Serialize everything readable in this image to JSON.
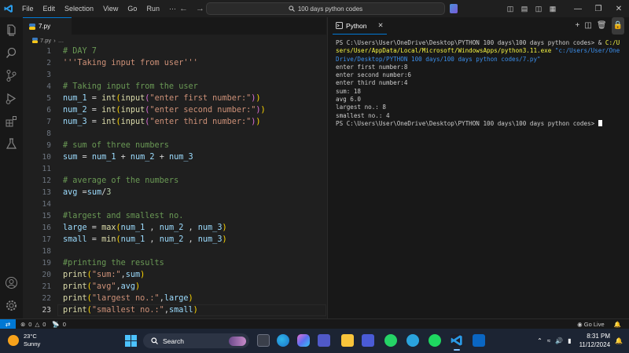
{
  "titlebar": {
    "menu": [
      "File",
      "Edit",
      "Selection",
      "View",
      "Go",
      "Run",
      "···"
    ],
    "search_text": "100 days python codes"
  },
  "editor": {
    "tab_label": "7.py",
    "breadcrumb_file": "7.py",
    "breadcrumb_more": "…",
    "line_numbers": [
      "1",
      "2",
      "3",
      "4",
      "5",
      "6",
      "7",
      "8",
      "9",
      "10",
      "11",
      "12",
      "13",
      "14",
      "15",
      "16",
      "17",
      "18",
      "19",
      "20",
      "21",
      "22",
      "23"
    ],
    "current_line": 23,
    "code": {
      "l1": "# DAY 7",
      "l2": "'''Taking input from user'''",
      "l4": "# Taking input from the user",
      "l5_var": "num_1",
      "l5_str": "\"enter first number:\"",
      "l6_var": "num_2",
      "l6_str": "\"enter second number:\"",
      "l7_var": "num_3",
      "l7_str": "\"enter third number:\"",
      "l9": "# sum of three numbers",
      "l12": "# average of the numbers",
      "l15": "#largest and smallest no.",
      "l19": "#printing the results",
      "l20_str": "\"sum:\"",
      "l21_str": "\"avg\"",
      "l22_str": "\"largest no.:\"",
      "l23_str": "\"smallest no.:\""
    }
  },
  "panel": {
    "tab_label": "Python",
    "terminal": {
      "cmd_prefix": "PS C:\\Users\\User\\OneDrive\\Desktop\\PYTHON 100 days\\100 days python codes> & ",
      "cmd_exe": "C:/Users/User/AppData/Local/Microsoft/WindowsApps/python3.11.exe",
      "cmd_arg": " \"c:/Users/User/OneDrive/Desktop/PYTHON 100 days/100 days python codes/7.py\"",
      "output": [
        "enter first number:8",
        "enter second number:6",
        "enter third number:4",
        "sum: 18",
        "avg 6.0",
        "largest no.: 8",
        "smallest no.: 4"
      ],
      "prompt": "PS C:\\Users\\User\\OneDrive\\Desktop\\PYTHON 100 days\\100 days python codes> "
    }
  },
  "statusbar": {
    "errors": "0",
    "warnings": "0",
    "ports": "0",
    "golive": "Go Live"
  },
  "taskbar": {
    "temperature": "23°C",
    "condition": "Sunny",
    "search_label": "Search",
    "time": "8:31 PM",
    "date": "11/12/2024"
  },
  "colors": {
    "accent": "#0078d4",
    "comment": "#6a9955",
    "string": "#ce9178",
    "function": "#dcdcaa",
    "variable": "#9cdcfe"
  }
}
